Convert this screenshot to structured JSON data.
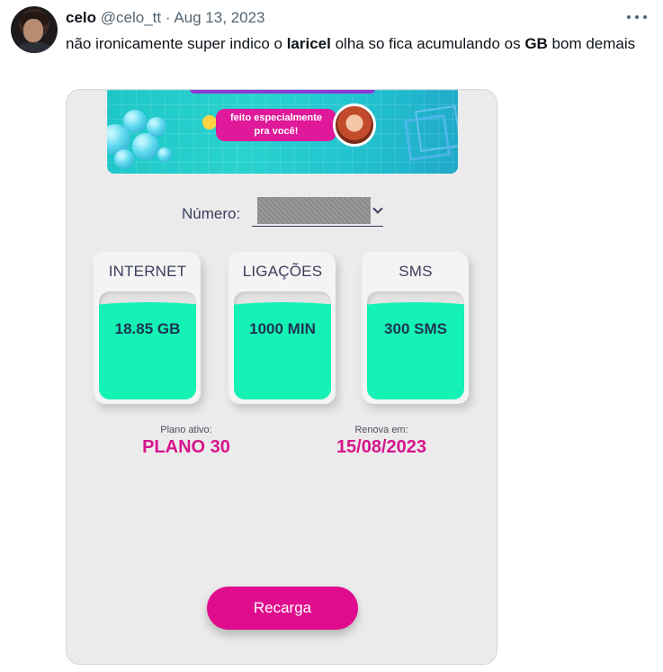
{
  "tweet": {
    "author_name": "celo",
    "author_handle": "@celo_tt",
    "separator": "·",
    "date": "Aug 13, 2023",
    "text_part1": "não ironicamente super indico o ",
    "text_bold1": "laricel",
    "text_part2": " olha so fica acumulando os ",
    "text_bold2": "GB",
    "text_part3": " bom demais"
  },
  "media": {
    "banner": {
      "tagline_line1": "feito especialmente",
      "tagline_line2": "pra você!"
    },
    "numero_label": "Número:",
    "cards": [
      {
        "title": "INTERNET",
        "value": "18.85 GB",
        "fill_level": 0.83
      },
      {
        "title": "LIGAÇÕES",
        "value": "1000 MIN",
        "fill_level": 0.83
      },
      {
        "title": "SMS",
        "value": "300 SMS",
        "fill_level": 0.83
      }
    ],
    "plan": {
      "label": "Plano ativo:",
      "value": "PLANO 30"
    },
    "renewal": {
      "label": "Renova em:",
      "value": "15/08/2023"
    },
    "recharge_button": "Recarga"
  },
  "colors": {
    "accent": "#d6148c",
    "fill": "#14f2b5",
    "banner": "#22c3cf"
  },
  "icons": [
    "more-options-icon",
    "chevron-down-icon",
    "smiley-icon"
  ]
}
